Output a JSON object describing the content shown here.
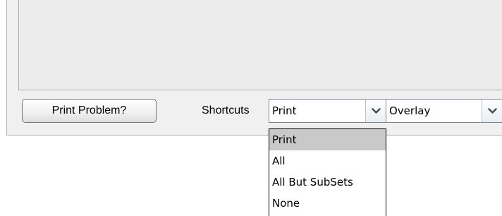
{
  "footer": {
    "print_problem_label": "Print Problem?",
    "shortcuts_label": "Shortcuts"
  },
  "shortcuts_select": {
    "selected": "Print",
    "options": [
      "Print",
      "All",
      "All But SubSets",
      "None"
    ],
    "highlighted_option": "Print"
  },
  "mode_select": {
    "selected": "Overlay"
  },
  "icons": {
    "combo_arrow": "chevron-down-icon"
  },
  "colors": {
    "dialog_bg": "#f0f0f0",
    "highlight": "#c9c9c9",
    "arrow_glyph": "#4a4a4a"
  }
}
